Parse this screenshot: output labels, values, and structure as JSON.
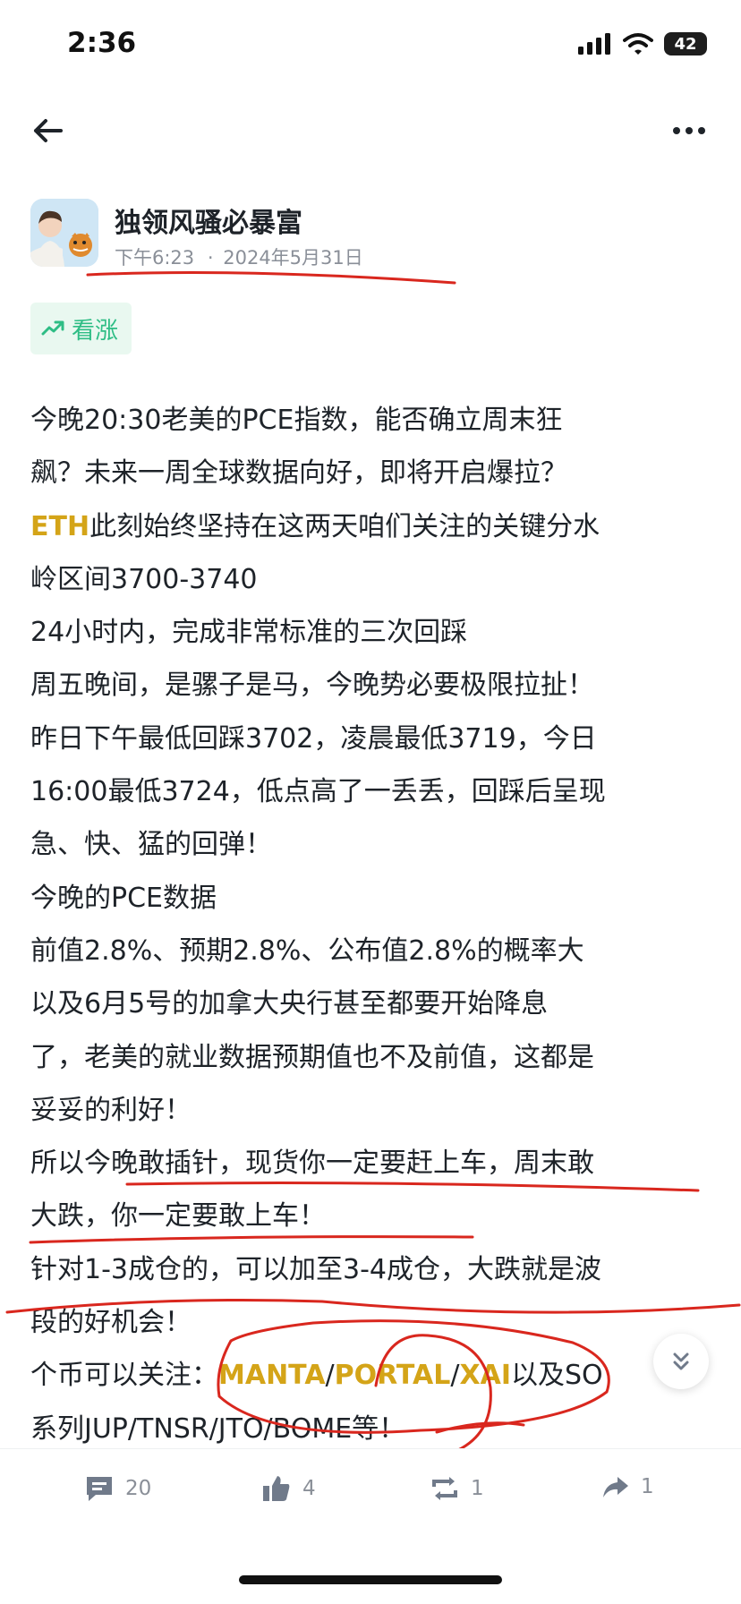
{
  "status_bar": {
    "time": "2:36",
    "battery": "42"
  },
  "author": {
    "name": "独领风骚必暴富",
    "time": "下午6:23",
    "separator": "·",
    "date": "2024年5月31日"
  },
  "sentiment": {
    "label": "看涨",
    "color": "#2ebd85"
  },
  "post": {
    "lines": [
      [
        {
          "t": "今晚20:30老美的PCE指数，能否确立周末狂"
        }
      ],
      [
        {
          "t": "飙？未来一周全球数据向好，即将开启爆拉？"
        }
      ],
      [
        {
          "t": "ETH",
          "coin": true
        },
        {
          "t": "此刻始终坚持在这两天咱们关注的关键分水"
        }
      ],
      [
        {
          "t": "岭区间3700-3740"
        }
      ],
      [
        {
          "t": "24小时内，完成非常标准的三次回踩"
        }
      ],
      [
        {
          "t": "周五晚间，是骡子是马，今晚势必要极限拉扯！"
        }
      ],
      [
        {
          "t": "昨日下午最低回踩3702，凌晨最低3719，今日"
        }
      ],
      [
        {
          "t": "16:00最低3724，低点高了一丢丢，回踩后呈现"
        }
      ],
      [
        {
          "t": "急、快、猛的回弹！"
        }
      ],
      [
        {
          "t": "今晚的PCE数据"
        }
      ],
      [
        {
          "t": "前值2.8%、预期2.8%、公布值2.8%的概率大"
        }
      ],
      [
        {
          "t": "以及6月5号的加拿大央行甚至都要开始降息"
        }
      ],
      [
        {
          "t": "了，老美的就业数据预期值也不及前值，这都是"
        }
      ],
      [
        {
          "t": "妥妥的利好！"
        }
      ],
      [
        {
          "t": "所以今晚敢插针，现货你一定要赶上车，周末敢"
        }
      ],
      [
        {
          "t": "大跌，你一定要敢上车！"
        }
      ],
      [
        {
          "t": "针对1-3成仓的，可以加至3-4成仓，大跌就是波"
        }
      ],
      [
        {
          "t": "段的好机会！"
        }
      ],
      [
        {
          "t": "个币可以关注："
        },
        {
          "t": "MANTA",
          "coin": true
        },
        {
          "t": "/"
        },
        {
          "t": "PORTAL",
          "coin": true
        },
        {
          "t": "/"
        },
        {
          "t": "XAI",
          "coin": true
        },
        {
          "t": "以及SO"
        }
      ],
      [
        {
          "t": "系列JUP/TNSR/JTO/BOME等！"
        }
      ]
    ]
  },
  "actions": {
    "comments": "20",
    "likes": "4",
    "reposts": "1",
    "shares": "1"
  },
  "colors": {
    "coin": "#d4a418",
    "annotation": "#d9271e",
    "muted": "#8a8f98"
  }
}
